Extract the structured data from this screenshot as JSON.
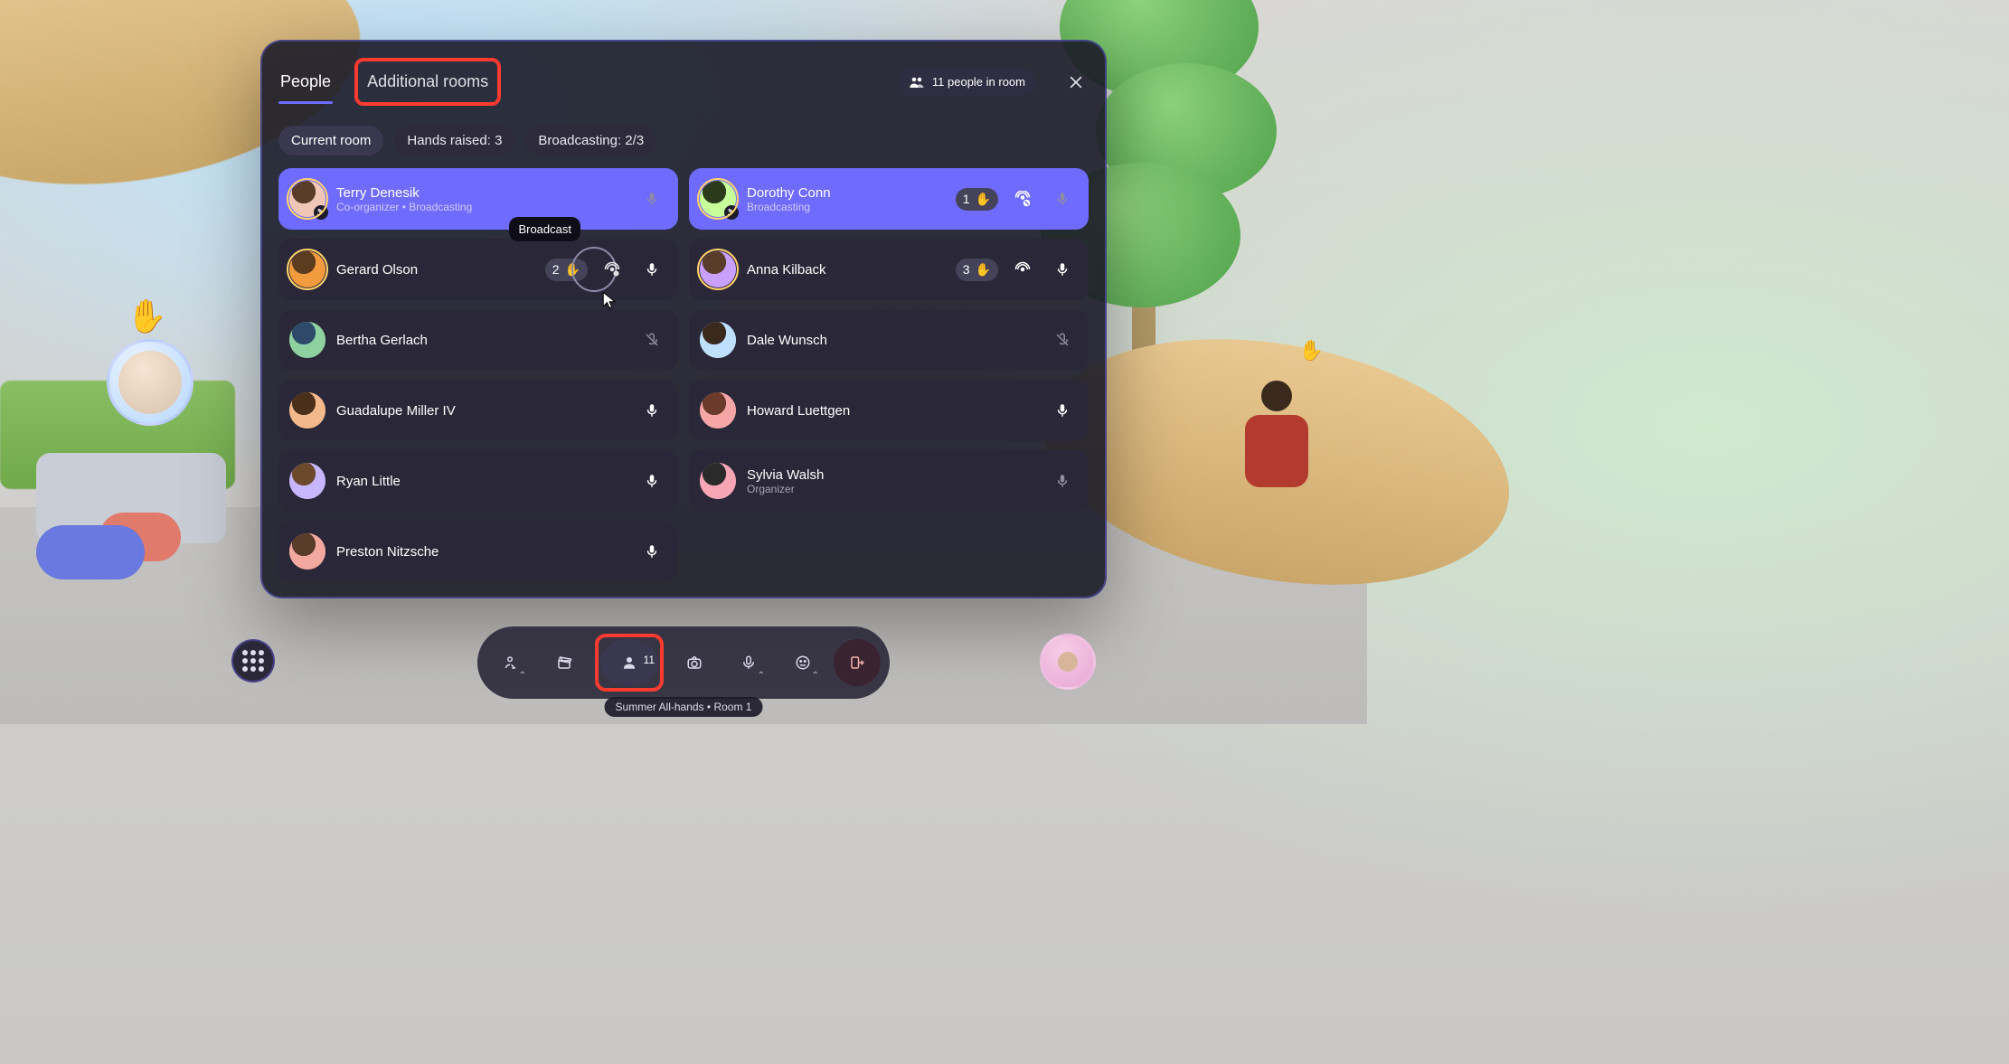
{
  "header": {
    "tabs": {
      "people": "People",
      "additionalRooms": "Additional rooms"
    },
    "roomCountLabel": "11 people in room"
  },
  "filters": {
    "currentRoom": "Current room",
    "handsRaised": "Hands raised: 3",
    "broadcasting": "Broadcasting: 2/3"
  },
  "tooltip": {
    "broadcast": "Broadcast"
  },
  "people": {
    "left": [
      {
        "name": "Terry Denesik",
        "sub": "Co-organizer • Broadcasting",
        "highlight": true,
        "ring": "gold",
        "badge": "broadcast",
        "mic": "dim",
        "avatar": "#f0c7b6"
      },
      {
        "name": "Gerard Olson",
        "hand": "2",
        "hoverBroadcast": true,
        "mic": "on",
        "ring": "gold",
        "avatar": "#f19a3e"
      },
      {
        "name": "Bertha Gerlach",
        "mic": "off-dim",
        "avatar": "#8ed0a0"
      },
      {
        "name": "Guadalupe Miller IV",
        "mic": "on",
        "avatar": "#f3b98a"
      },
      {
        "name": "Ryan Little",
        "mic": "on",
        "avatar": "#c8b6ff"
      },
      {
        "name": "Preston Nitzsche",
        "mic": "on",
        "avatar": "#f4a9a0"
      }
    ],
    "right": [
      {
        "name": "Dorothy Conn",
        "sub": "Broadcasting",
        "highlight": true,
        "hand": "1",
        "ring": "gold",
        "badge": "broadcast",
        "bcast": "stop",
        "mic": "dim",
        "avatar": "#c7ff9b"
      },
      {
        "name": "Anna Kilback",
        "hand": "3",
        "bcast": "on",
        "mic": "on",
        "ring": "gold",
        "avatar": "#caa0ff"
      },
      {
        "name": "Dale Wunsch",
        "mic": "off-dim",
        "avatar": "#bfe0ff"
      },
      {
        "name": "Howard Luettgen",
        "mic": "on",
        "avatar": "#f6a6a6"
      },
      {
        "name": "Sylvia Walsh",
        "sub": "Organizer",
        "mic": "dim",
        "avatar": "#f6a6b5"
      }
    ]
  },
  "toolbar": {
    "peopleCount": "11",
    "label": "Summer All-hands • Room 1"
  },
  "icons": {
    "hand": "✋"
  }
}
